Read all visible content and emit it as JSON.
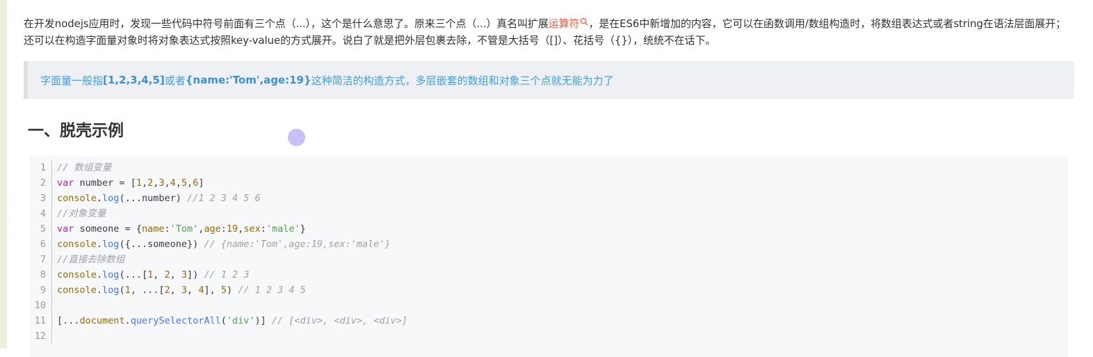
{
  "article": {
    "paragraph_part1": "在开发nodejs应用时，发现一些代码中符号前面有三个点（...），这个是什么意思了。原来三个点（...）真名叫扩展",
    "paragraph_link": "运算符",
    "paragraph_part2": "，是在ES6中新增加的内容，它可以在函数调用/数组构造时，将数组表达式或者string在语法层面展开；还可以在构造字面量对象时将对象表达式按照key-value的方式展开。说白了就是把外层包裹去除，不管是大括号（[]）、花括号（{}），统统不在话下。",
    "quote_part1": "字面量一般指 ",
    "quote_bold1": "[1,2,3,4,5]",
    "quote_part2": " 或者 ",
    "quote_bold2": "{name:'Tom',age:19}",
    "quote_part3": " 这种简洁的构造方式，多层嵌套的数组和对象三个点就无能为力了",
    "heading": "一、脱壳示例"
  },
  "code": {
    "lines": [
      {
        "n": "1",
        "tokens": [
          [
            "cm",
            "// 数组变量"
          ]
        ]
      },
      {
        "n": "2",
        "tokens": [
          [
            "kw",
            "var"
          ],
          [
            "",
            " number = ["
          ],
          [
            "num",
            "1"
          ],
          [
            "",
            ","
          ],
          [
            "num",
            "2"
          ],
          [
            "",
            ","
          ],
          [
            "num",
            "3"
          ],
          [
            "",
            ","
          ],
          [
            "num",
            "4"
          ],
          [
            "",
            ","
          ],
          [
            "num",
            "5"
          ],
          [
            "",
            ","
          ],
          [
            "num",
            "6"
          ],
          [
            "",
            "]"
          ]
        ]
      },
      {
        "n": "3",
        "tokens": [
          [
            "obj",
            "console"
          ],
          [
            "",
            "."
          ],
          [
            "fn",
            "log"
          ],
          [
            "",
            "(...number) "
          ],
          [
            "cm",
            "//1 2 3 4 5 6"
          ]
        ]
      },
      {
        "n": "4",
        "tokens": [
          [
            "cm",
            "//对象变量"
          ]
        ]
      },
      {
        "n": "5",
        "tokens": [
          [
            "kw",
            "var"
          ],
          [
            "",
            " someone = {"
          ],
          [
            "prop",
            "name"
          ],
          [
            "",
            ":"
          ],
          [
            "str",
            "'Tom'"
          ],
          [
            "",
            ","
          ],
          [
            "prop",
            "age"
          ],
          [
            "",
            ":"
          ],
          [
            "num",
            "19"
          ],
          [
            "",
            ","
          ],
          [
            "prop",
            "sex"
          ],
          [
            "",
            ":"
          ],
          [
            "str",
            "'male'"
          ],
          [
            "",
            "}"
          ]
        ]
      },
      {
        "n": "6",
        "tokens": [
          [
            "obj",
            "console"
          ],
          [
            "",
            "."
          ],
          [
            "fn",
            "log"
          ],
          [
            "",
            "({...someone}) "
          ],
          [
            "cm",
            "// {name:'Tom',age:19,sex:'male'}"
          ]
        ]
      },
      {
        "n": "7",
        "tokens": [
          [
            "cm",
            "//直接去除数组"
          ]
        ]
      },
      {
        "n": "8",
        "tokens": [
          [
            "obj",
            "console"
          ],
          [
            "",
            "."
          ],
          [
            "fn",
            "log"
          ],
          [
            "",
            "(...["
          ],
          [
            "num",
            "1"
          ],
          [
            "",
            ", "
          ],
          [
            "num",
            "2"
          ],
          [
            "",
            ", "
          ],
          [
            "num",
            "3"
          ],
          [
            "",
            "]) "
          ],
          [
            "cm",
            "// 1 2 3"
          ]
        ]
      },
      {
        "n": "9",
        "tokens": [
          [
            "obj",
            "console"
          ],
          [
            "",
            "."
          ],
          [
            "fn",
            "log"
          ],
          [
            "",
            "("
          ],
          [
            "num",
            "1"
          ],
          [
            "",
            ", ...["
          ],
          [
            "num",
            "2"
          ],
          [
            "",
            ", "
          ],
          [
            "num",
            "3"
          ],
          [
            "",
            ", "
          ],
          [
            "num",
            "4"
          ],
          [
            "",
            "], "
          ],
          [
            "num",
            "5"
          ],
          [
            "",
            ") "
          ],
          [
            "cm",
            "// 1 2 3 4 5"
          ]
        ]
      },
      {
        "n": "10",
        "tokens": []
      },
      {
        "n": "11",
        "tokens": [
          [
            "",
            "[..."
          ],
          [
            "obj",
            "document"
          ],
          [
            "",
            "."
          ],
          [
            "fn",
            "querySelectorAll"
          ],
          [
            "",
            "("
          ],
          [
            "str",
            "'div'"
          ],
          [
            "",
            ")] "
          ],
          [
            "cm",
            "// [<div>, <div>, <div>]"
          ]
        ]
      },
      {
        "n": "12",
        "tokens": []
      }
    ]
  }
}
